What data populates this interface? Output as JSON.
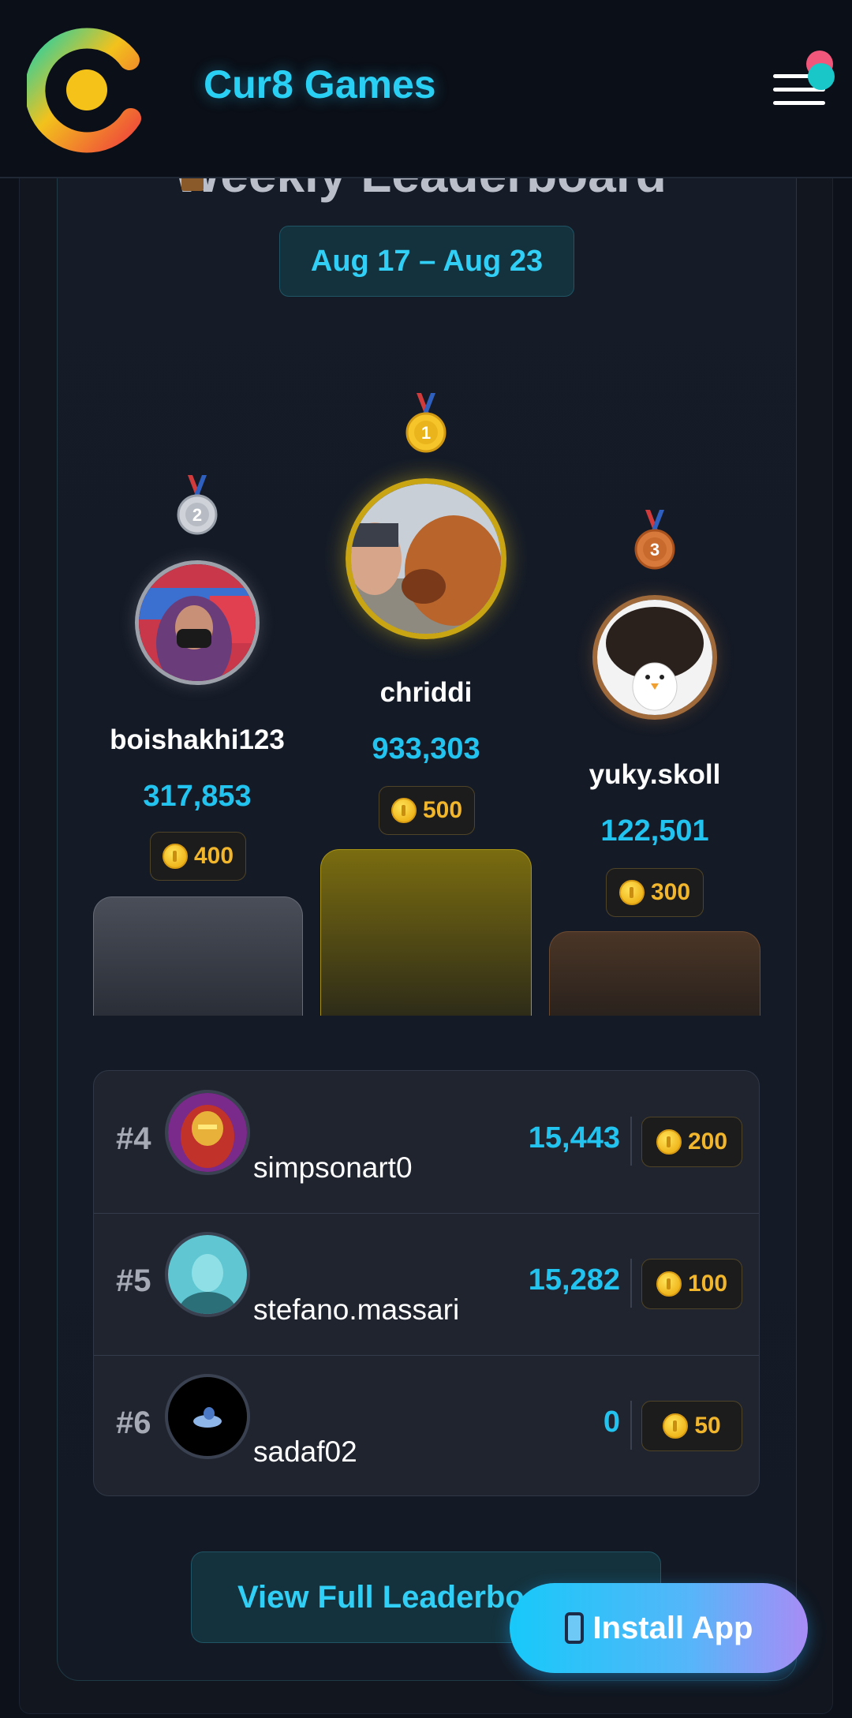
{
  "header": {
    "brand": "Cur8 Games"
  },
  "leaderboard": {
    "title": "Weekly Leaderboard",
    "date_range": "Aug 17 – Aug 23",
    "podium": [
      {
        "place": "2",
        "name": "boishakhi123",
        "score": "317,853",
        "coins": "400"
      },
      {
        "place": "1",
        "name": "chriddi",
        "score": "933,303",
        "coins": "500"
      },
      {
        "place": "3",
        "name": "yuky.skoll",
        "score": "122,501",
        "coins": "300"
      }
    ],
    "list": [
      {
        "rank": "#4",
        "name": "simpsonart0",
        "score": "15,443",
        "coins": "200"
      },
      {
        "rank": "#5",
        "name": "stefano.massari",
        "score": "15,282",
        "coins": "100"
      },
      {
        "rank": "#6",
        "name": "sadaf02",
        "score": "0",
        "coins": "50"
      }
    ],
    "view_full_label": "View Full Leaderboard"
  },
  "install": {
    "label": "Install App"
  },
  "colors": {
    "accent": "#22c3ef",
    "gold": "#c9a413",
    "silver": "#a9adb6",
    "bronze": "#a06a3a",
    "background": "#0d1119"
  }
}
